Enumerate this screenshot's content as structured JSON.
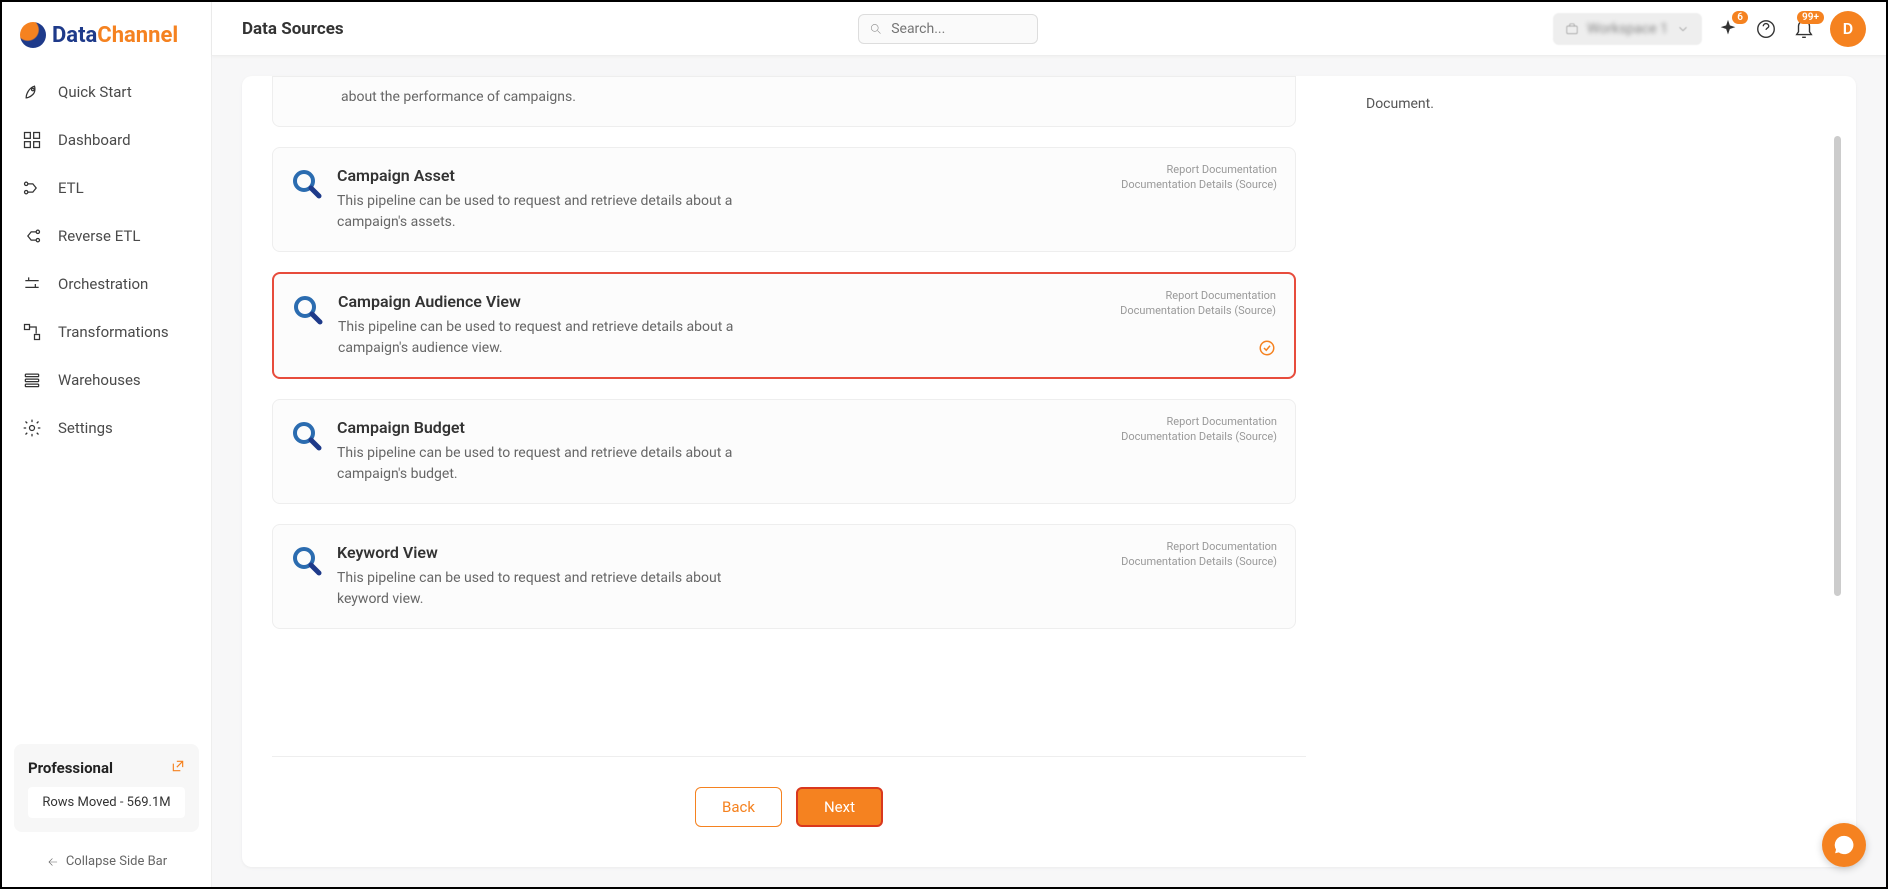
{
  "brand": {
    "part1": "Data",
    "part2": "Channel"
  },
  "nav": {
    "items": [
      {
        "label": "Quick Start"
      },
      {
        "label": "Dashboard"
      },
      {
        "label": "ETL"
      },
      {
        "label": "Reverse ETL"
      },
      {
        "label": "Orchestration"
      },
      {
        "label": "Transformations"
      },
      {
        "label": "Warehouses"
      },
      {
        "label": "Settings"
      }
    ]
  },
  "plan": {
    "title": "Professional",
    "rows_moved": "Rows Moved - 569.1M"
  },
  "collapse_label": "Collapse Side Bar",
  "header": {
    "title": "Data Sources",
    "search_placeholder": "Search...",
    "workspace": "Workspace 1",
    "ai_badge": "6",
    "bell_badge": "99+",
    "avatar": "D"
  },
  "right_text": "Document.",
  "partial_top_desc": "about the performance of campaigns.",
  "cards": [
    {
      "title": "Campaign Asset",
      "desc": "This pipeline can be used to request and retrieve details about a campaign's assets.",
      "link1": "Report Documentation",
      "link2": "Documentation Details (Source)"
    },
    {
      "title": "Campaign Audience View",
      "desc": "This pipeline can be used to request and retrieve details about a campaign's audience view.",
      "link1": "Report Documentation",
      "link2": "Documentation Details (Source)"
    },
    {
      "title": "Campaign Budget",
      "desc": "This pipeline can be used to request and retrieve details about a campaign's budget.",
      "link1": "Report Documentation",
      "link2": "Documentation Details (Source)"
    },
    {
      "title": "Keyword View",
      "desc": "This pipeline can be used to request and retrieve details about keyword view.",
      "link1": "Report Documentation",
      "link2": "Documentation Details (Source)"
    }
  ],
  "buttons": {
    "back": "Back",
    "next": "Next"
  }
}
